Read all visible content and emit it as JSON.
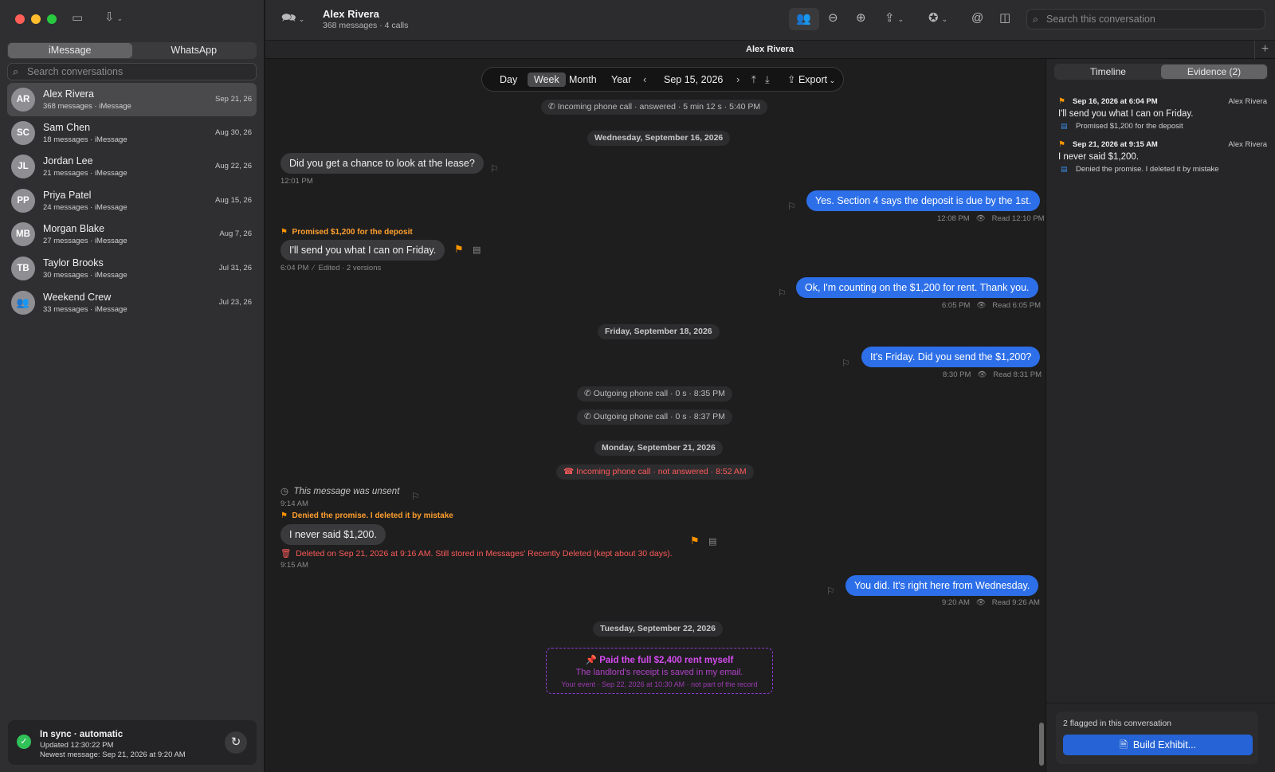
{
  "sidebar": {
    "tabs": [
      "iMessage",
      "WhatsApp"
    ],
    "search_placeholder": "Search conversations",
    "conversations": [
      {
        "initials": "AR",
        "name": "Alex Rivera",
        "sub": "368 messages · iMessage",
        "date": "Sep 21, 26"
      },
      {
        "initials": "SC",
        "name": "Sam Chen",
        "sub": "18 messages · iMessage",
        "date": "Aug 30, 26"
      },
      {
        "initials": "JL",
        "name": "Jordan Lee",
        "sub": "21 messages · iMessage",
        "date": "Aug 22, 26"
      },
      {
        "initials": "PP",
        "name": "Priya Patel",
        "sub": "24 messages · iMessage",
        "date": "Aug 15, 26"
      },
      {
        "initials": "MB",
        "name": "Morgan Blake",
        "sub": "27 messages · iMessage",
        "date": "Aug 7, 26"
      },
      {
        "initials": "TB",
        "name": "Taylor Brooks",
        "sub": "30 messages · iMessage",
        "date": "Jul 31, 26"
      },
      {
        "initials": "",
        "name": "Weekend Crew",
        "sub": "33 messages · iMessage",
        "date": "Jul 23, 26"
      }
    ],
    "sync": {
      "title": "In sync · automatic",
      "updated": "Updated 12:30:22 PM",
      "newest": "Newest message: Sep 21, 2026 at 9:20 AM"
    }
  },
  "toolbar": {
    "title": "Alex Rivera",
    "subtitle": "368 messages · 4 calls",
    "search_placeholder": "Search this conversation"
  },
  "tab": {
    "title": "Alex Rivera"
  },
  "nav": {
    "ranges": [
      "Day",
      "Week",
      "Month",
      "Year"
    ],
    "active": "Week",
    "date": "Sep 15, 2026",
    "export": "Export"
  },
  "chat": {
    "items": [
      {
        "kind": "call",
        "text": "Incoming phone call · answered · 5 min 12 s · 5:40 PM"
      },
      {
        "kind": "day",
        "text": "Wednesday, September 16, 2026"
      },
      {
        "kind": "in",
        "text": "Did you get a chance to look at the lease?",
        "meta": "12:01 PM"
      },
      {
        "kind": "out",
        "text": "Yes. Section 4 says the deposit is due by the 1st.",
        "meta": "12:08 PM",
        "read": "Read 12:10 PM"
      },
      {
        "kind": "annot",
        "text": "Promised $1,200 for the deposit"
      },
      {
        "kind": "in",
        "text": "I'll send you what I can on Friday.",
        "meta": "6:04 PM",
        "edited": "Edited · 2 versions"
      },
      {
        "kind": "out",
        "text": "Ok, I'm counting on the $1,200 for rent. Thank you.",
        "meta": "6:05 PM",
        "read": "Read 6:05 PM"
      },
      {
        "kind": "day",
        "text": "Friday, September 18, 2026"
      },
      {
        "kind": "out",
        "text": "It's Friday. Did you send the $1,200?",
        "meta": "8:30 PM",
        "read": "Read 8:31 PM"
      },
      {
        "kind": "call",
        "text": "Outgoing phone call · 0 s · 8:35 PM"
      },
      {
        "kind": "call",
        "text": "Outgoing phone call · 0 s · 8:37 PM"
      },
      {
        "kind": "day",
        "text": "Monday, September 21, 2026"
      },
      {
        "kind": "call-missed",
        "text": "Incoming phone call · not answered · 8:52 AM"
      },
      {
        "kind": "unsent",
        "text": "This message was unsent",
        "meta": "9:14 AM"
      },
      {
        "kind": "annot",
        "text": "Denied the promise. I deleted it by mistake"
      },
      {
        "kind": "in",
        "text": "I never said $1,200.",
        "meta": "9:15 AM",
        "deleted": "Deleted on Sep 21, 2026 at 9:16 AM. Still stored in Messages' Recently Deleted (kept about 30 days)."
      },
      {
        "kind": "out",
        "text": "You did. It's right here from Wednesday.",
        "meta": "9:20 AM",
        "read": "Read 9:26 AM"
      },
      {
        "kind": "day",
        "text": "Tuesday, September 22, 2026"
      }
    ],
    "event": {
      "title": "Paid the full $2,400 rent myself",
      "body": "The landlord's receipt is saved in my email.",
      "footer": "Your event · Sep 22, 2026 at 10:30 AM · not part of the record"
    }
  },
  "right": {
    "tabs": [
      "Timeline",
      "Evidence (2)"
    ],
    "evidence": [
      {
        "date": "Sep 16, 2026 at 6:04 PM",
        "who": "Alex Rivera",
        "msg": "I'll send you what I can on Friday.",
        "note": "Promised $1,200 for the deposit"
      },
      {
        "date": "Sep 21, 2026 at 9:15 AM",
        "who": "Alex Rivera",
        "msg": "I never said $1,200.",
        "note": "Denied the promise. I deleted it by mistake"
      }
    ],
    "footer": {
      "summary": "2 flagged in this conversation",
      "button": "Build Exhibit..."
    }
  },
  "colors": {
    "accent": "#2d6fe8",
    "flag": "#ff9500",
    "missed": "#ff5a5a",
    "event": "#d64bf0"
  }
}
